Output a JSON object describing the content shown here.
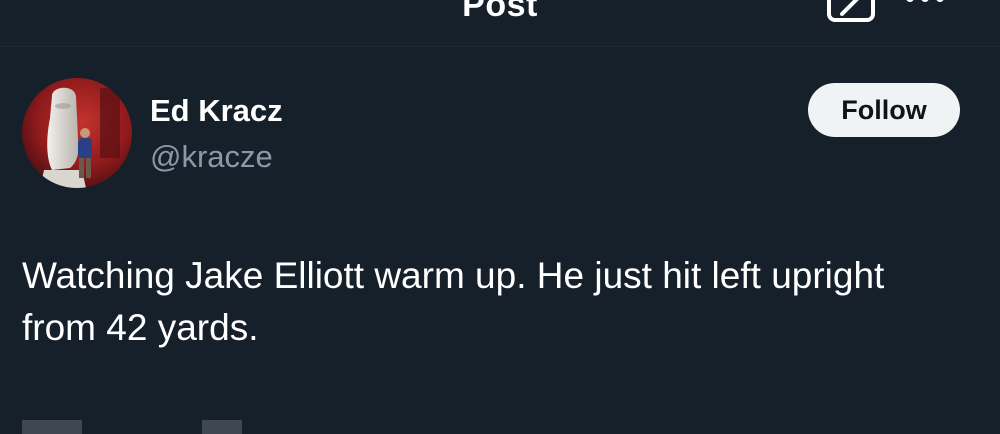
{
  "header": {
    "title": "Post",
    "back_icon": "arrow-left-icon",
    "compose_icon": "compose-icon",
    "more_icon": "more-horizontal-icon"
  },
  "author": {
    "display_name": "Ed Kracz",
    "handle": "@kracze"
  },
  "actions": {
    "follow_label": "Follow"
  },
  "post": {
    "text": "Watching Jake Elliott warm up. He just hit left upright from 42 yards."
  },
  "colors": {
    "background": "#15202b",
    "text_primary": "#ffffff",
    "text_secondary": "#8b98a5",
    "button_bg": "#eff3f4",
    "button_text": "#0f1419"
  }
}
